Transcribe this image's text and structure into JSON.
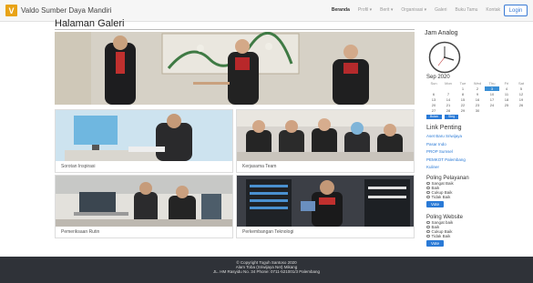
{
  "header": {
    "logo_letter": "V",
    "brand": "Valdo Sumber Daya Mandiri",
    "nav": [
      "Beranda",
      "Profil ▾",
      "Berit ▾",
      "Organisasi ▾",
      "Galeri",
      "Buku Tamu",
      "Kontak"
    ],
    "login": "Login"
  },
  "main": {
    "title": "Halaman Galeri",
    "gallery": [
      {
        "caption": "Sorotan Inspirasi"
      },
      {
        "caption": "Kerjasama Team"
      },
      {
        "caption": "Pemeriksaan Rutin"
      },
      {
        "caption": "Perkembangan Teknologi"
      }
    ]
  },
  "sidebar": {
    "clock_title": "Jam Analog",
    "calendar": {
      "month": "Sep 2020",
      "day_headers": [
        "Sun",
        "Mon",
        "Tue",
        "Wed",
        "Thu",
        "Fri",
        "Sat"
      ],
      "days": [
        "",
        "",
        "1",
        "2",
        "3",
        "4",
        "5",
        "6",
        "7",
        "8",
        "9",
        "10",
        "11",
        "12",
        "13",
        "14",
        "15",
        "16",
        "17",
        "18",
        "19",
        "20",
        "21",
        "22",
        "23",
        "24",
        "25",
        "26",
        "27",
        "28",
        "29",
        "30",
        "",
        "",
        ""
      ],
      "today": "3",
      "buttons": [
        "Bulan",
        "Skrg"
      ]
    },
    "links_title": "Link Penting",
    "links": [
      "Aset Baru Sriwijaya",
      "Pasar Indo",
      "PROP Sumsel",
      "PEMKOT Palembang",
      "Kuliner"
    ],
    "poll1": {
      "title": "Poling Pelayanan",
      "options": [
        "Sangat Baik",
        "Baik",
        "Cukup Baik",
        "Tidak Baik"
      ],
      "button": "Vote"
    },
    "poll2": {
      "title": "Poling Website",
      "options": [
        "Sangat baik",
        "Baik",
        "Cukup Baik",
        "Tidak Baik"
      ],
      "button": "Vote"
    }
  },
  "footer": {
    "line1": "© Copyright Toguh Santoso 2020",
    "line2": "Alam Toba (Sriwijaya Net) Mikang",
    "line3": "JL. HM Rasyidu No. 34 Phone: 0711-521001/3 Palembang"
  },
  "colors": {
    "accent": "#2a7ad6",
    "logo": "#e8a317",
    "footer": "#2f3238"
  }
}
